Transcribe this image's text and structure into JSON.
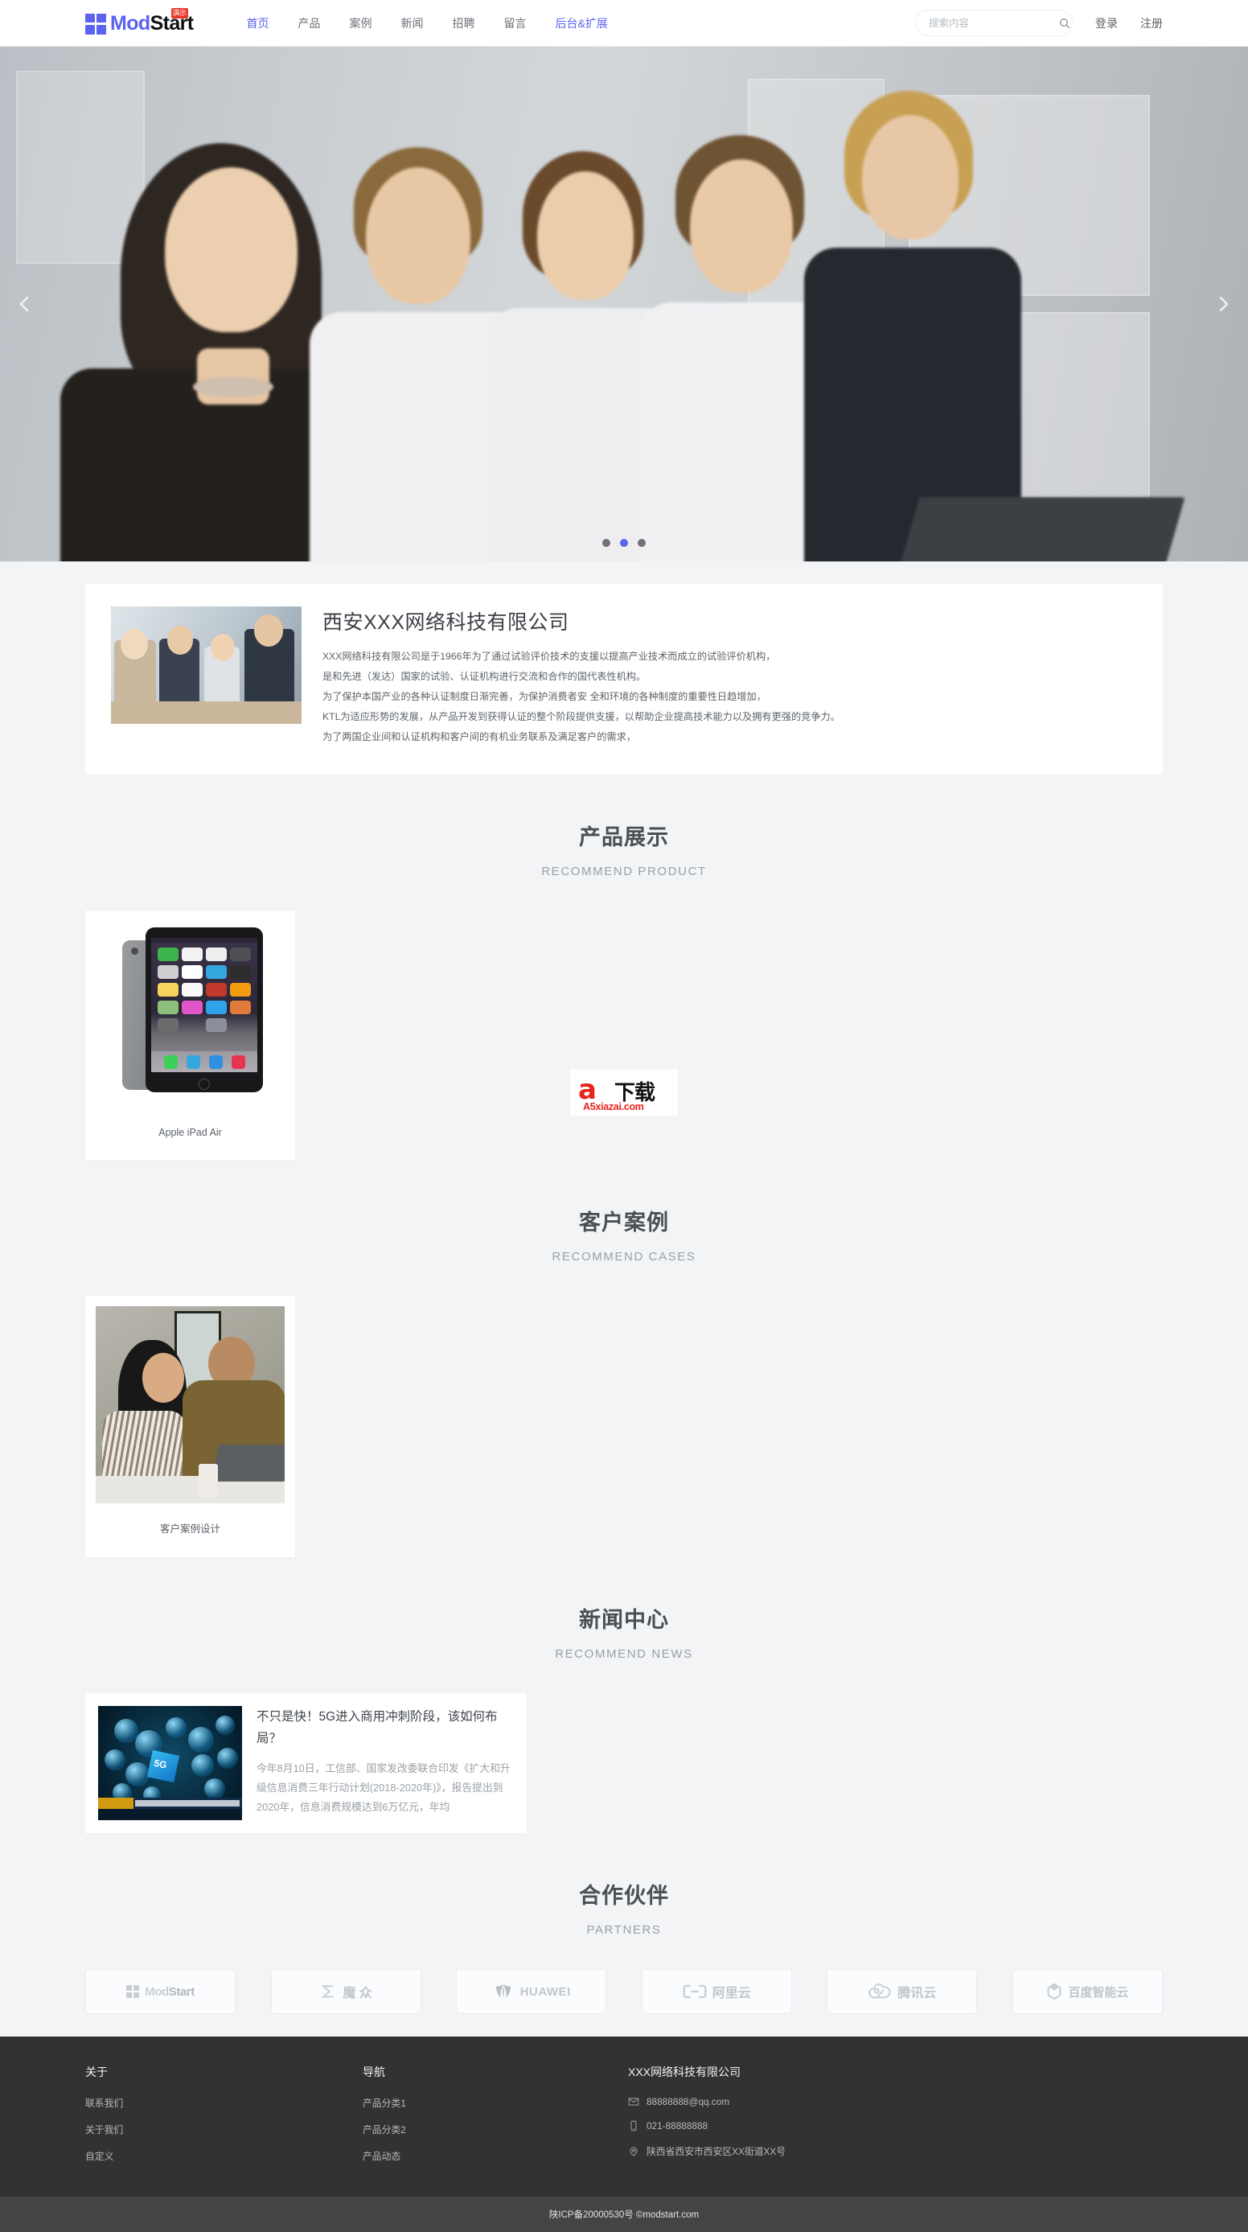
{
  "header": {
    "brand": {
      "part1": "Mod",
      "part2": "Start",
      "badge": "演示"
    },
    "nav": [
      {
        "label": "首页",
        "state": "active"
      },
      {
        "label": "产品",
        "state": "normal"
      },
      {
        "label": "案例",
        "state": "normal"
      },
      {
        "label": "新闻",
        "state": "normal"
      },
      {
        "label": "招聘",
        "state": "normal"
      },
      {
        "label": "留言",
        "state": "normal"
      },
      {
        "label": "后台&扩展",
        "state": "accent"
      }
    ],
    "search": {
      "placeholder": "搜索内容",
      "value": "",
      "icon": "search-icon"
    },
    "login": "登录",
    "register": "注册"
  },
  "banner": {
    "prev_icon": "chevron-left-icon",
    "next_icon": "chevron-right-icon",
    "dots": 3,
    "active_dot": 1
  },
  "about": {
    "title": "西安XXX网络科技有限公司",
    "paragraphs": [
      "XXX网络科技有限公司是于1966年为了通过试验评价技术的支援以提高产业技术而成立的试验评价机构，",
      "是和先进（发达）国家的试验、认证机构进行交流和合作的国代表性机构。",
      "为了保护本国产业的各种认证制度日渐完善，为保护消费者安 全和环境的各种制度的重要性日趋增加，",
      "KTL为适应形势的发展，从产品开发到获得认证的整个阶段提供支援，以帮助企业提高技术能力以及拥有更强的竞争力。",
      "为了两国企业间和认证机构和客户间的有机业务联系及满足客户的需求，"
    ]
  },
  "sections": {
    "product": {
      "title": "产品展示",
      "subtitle": "RECOMMEND PRODUCT"
    },
    "cases": {
      "title": "客户案例",
      "subtitle": "RECOMMEND CASES"
    },
    "news": {
      "title": "新闻中心",
      "subtitle": "RECOMMEND NEWS"
    },
    "partners": {
      "title": "合作伙伴",
      "subtitle": "PARTNERS"
    }
  },
  "products": [
    {
      "title": "Apple iPad Air"
    }
  ],
  "cases": [
    {
      "title": "客户案例设计"
    }
  ],
  "news": [
    {
      "title": "不只是快！5G进入商用冲刺阶段，该如何布局？",
      "desc": "今年8月10日，工信部、国家发改委联合印发《扩大和升级信息消费三年行动计划(2018-2020年)》，报告提出到2020年，信息消费规模达到6万亿元，年均"
    }
  ],
  "watermark": {
    "letter": "a",
    "digit": "5",
    "cn": "下载",
    "domain": "A5xiazai.com"
  },
  "partners": [
    {
      "name": "ModStart",
      "icon": "modstart-logo-icon"
    },
    {
      "name": "魔 众",
      "icon": "mozhong-logo-icon"
    },
    {
      "name": "HUAWEI",
      "icon": "huawei-logo-icon"
    },
    {
      "name": "阿里云",
      "icon": "aliyun-logo-icon"
    },
    {
      "name": "腾讯云",
      "icon": "tencentcloud-logo-icon"
    },
    {
      "name": "百度智能云",
      "icon": "baiduyun-logo-icon"
    }
  ],
  "footer": {
    "col1": {
      "heading": "关于",
      "links": [
        "联系我们",
        "关于我们",
        "自定义"
      ]
    },
    "col2": {
      "heading": "导航",
      "links": [
        "产品分类1",
        "产品分类2",
        "产品动态"
      ]
    },
    "col3": {
      "heading": "XXX网络科技有限公司",
      "email": "88888888@qq.com",
      "phone": "021-88888888",
      "address": "陕西省西安市西安区XX街道XX号"
    },
    "copyright": "陕ICP备20000530号 ©modstart.com"
  }
}
